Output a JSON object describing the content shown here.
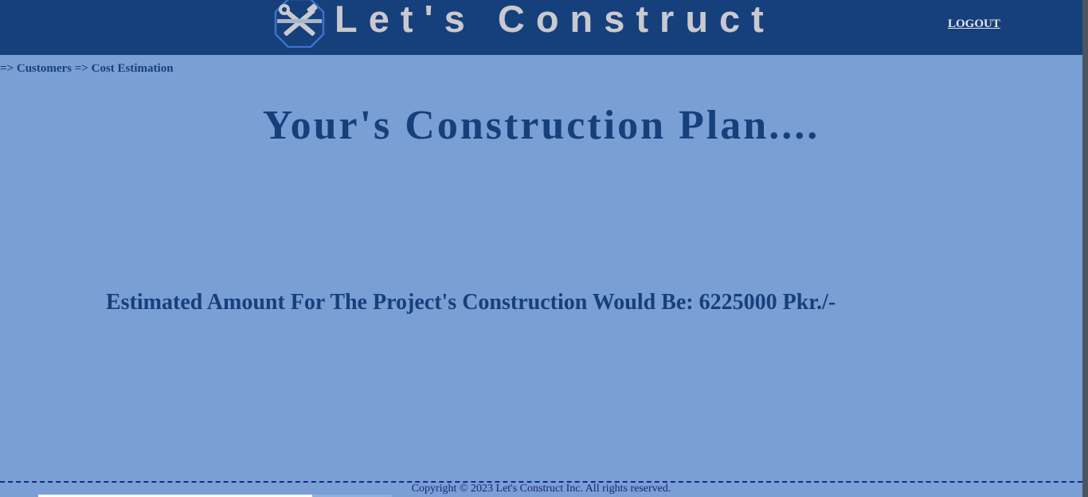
{
  "header": {
    "brand": "Let's Construct",
    "logo_icon": "tools-icon",
    "logout_label": "LOGOUT"
  },
  "breadcrumb": {
    "sep1": "=> ",
    "item1": "Customers",
    "sep2": " => ",
    "item2": "Cost Estimation"
  },
  "main": {
    "title": "Your's Construction Plan....",
    "estimate": "Estimated Amount For The Project's Construction Would Be: 6225000 Pkr./-"
  },
  "footer": {
    "copyright": "Copyright © 2023 Let's Construct Inc. All rights reserved."
  },
  "colors": {
    "header_bg": "#16407c",
    "page_bg": "#7a9fd4",
    "brand_text": "#c9c9cf",
    "heading_text": "#16407c"
  }
}
